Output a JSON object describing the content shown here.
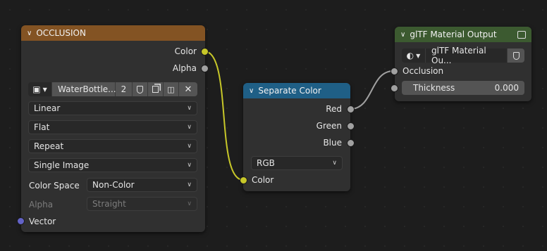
{
  "colors": {
    "occlusion_header": "#835323",
    "separate_header": "#1f5f86",
    "output_header": "#3c5a30",
    "socket_color": "#c7c729",
    "socket_float": "#a1a1a1",
    "socket_vector": "#6363c7",
    "link_color": "#c7c729",
    "link_float": "#a1a1a1"
  },
  "occlusion_node": {
    "title": "OCCLUSION",
    "outputs": {
      "color": "Color",
      "alpha": "Alpha"
    },
    "image": {
      "icon": "image-icon",
      "name": "WaterBottle...",
      "users": "2"
    },
    "interpolation": "Linear",
    "projection": "Flat",
    "extension": "Repeat",
    "source": "Single Image",
    "color_space_label": "Color Space",
    "color_space_value": "Non-Color",
    "alpha_label": "Alpha",
    "alpha_value": "Straight",
    "vector_label": "Vector"
  },
  "separate_node": {
    "title": "Separate Color",
    "outputs": {
      "red": "Red",
      "green": "Green",
      "blue": "Blue"
    },
    "mode": "RGB",
    "input_color": "Color"
  },
  "output_node": {
    "title": "glTF Material Output",
    "group_name": "glTF Material Ou...",
    "inputs": {
      "occlusion": "Occlusion",
      "thickness_label": "Thickness",
      "thickness_value": "0.000"
    }
  }
}
